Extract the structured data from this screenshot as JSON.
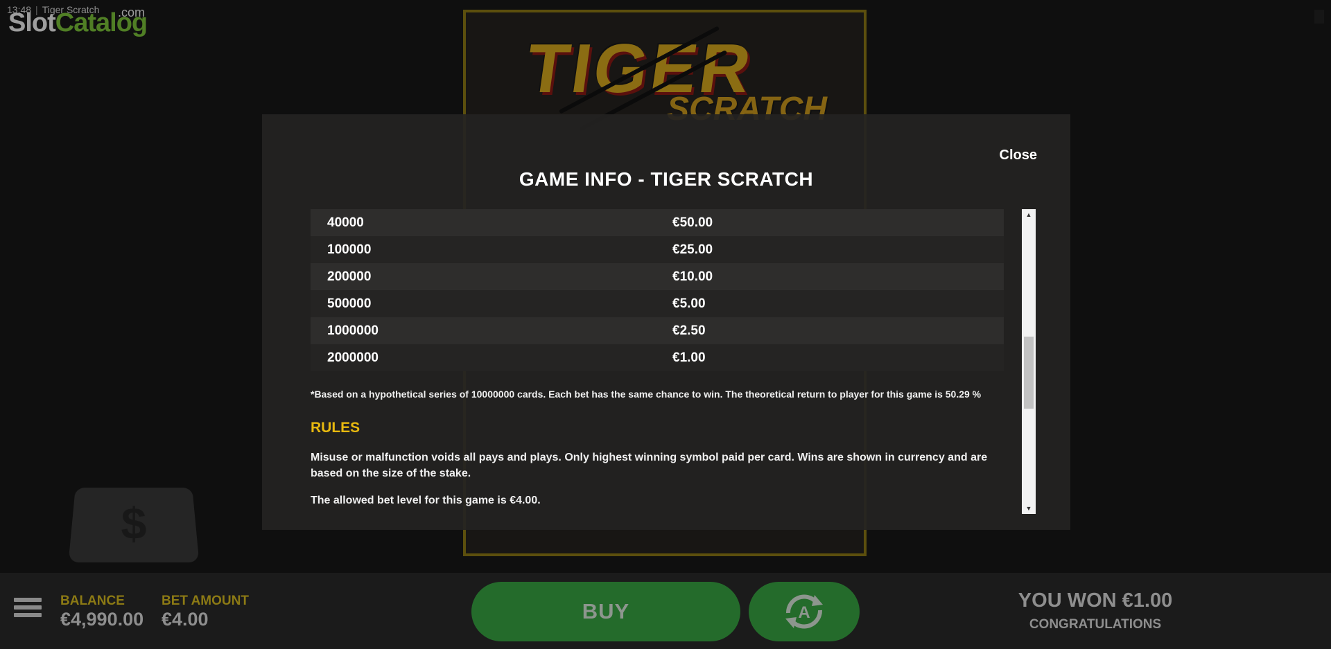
{
  "header": {
    "time": "13:48",
    "window_title": "Tiger Scratch",
    "brand_part1": "Slot",
    "brand_part2": "Catalog",
    "brand_suffix": ".com"
  },
  "card": {
    "title": "TIGER",
    "subtitle": "SCRATCH"
  },
  "modal": {
    "close_label": "Close",
    "title": "GAME INFO - TIGER SCRATCH",
    "paytable": [
      {
        "cards": "40000",
        "prize": "€50.00"
      },
      {
        "cards": "100000",
        "prize": "€25.00"
      },
      {
        "cards": "200000",
        "prize": "€10.00"
      },
      {
        "cards": "500000",
        "prize": "€5.00"
      },
      {
        "cards": "1000000",
        "prize": "€2.50"
      },
      {
        "cards": "2000000",
        "prize": "€1.00"
      }
    ],
    "note": "*Based on a hypothetical series of 10000000 cards. Each bet has the same chance to win. The theoretical return to player for this game is 50.29 %",
    "rules_heading": "RULES",
    "rules_text_1": "Misuse or malfunction voids all pays and plays. Only highest winning symbol paid per card. Wins are shown in currency and are based on the size of the stake.",
    "rules_text_2": "The allowed bet level for this game is €4.00."
  },
  "controls": {
    "dollar_symbol": "$",
    "balance_label": "BALANCE",
    "balance_value": "€4,990.00",
    "bet_label": "BET AMOUNT",
    "bet_value": "€4.00",
    "buy_label": "BUY",
    "auto_icon": "autoplay-icon",
    "won_text": "YOU WON €1.00",
    "won_sub": "CONGRATULATIONS"
  },
  "colors": {
    "accent_yellow": "#e8b90f",
    "buy_green": "#246b2b",
    "brand_green": "#7cc33a"
  }
}
